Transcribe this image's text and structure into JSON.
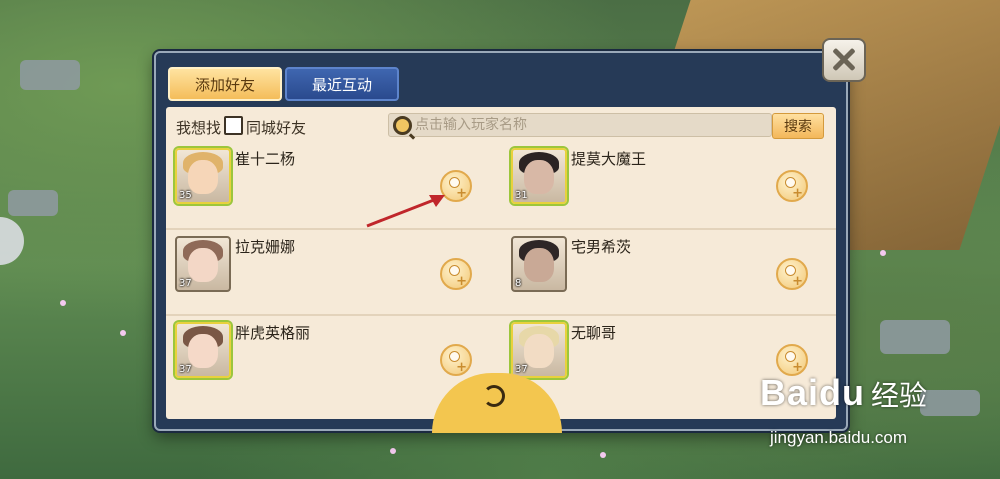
{
  "tabs": [
    {
      "label": "添加好友",
      "active": true
    },
    {
      "label": "最近互动",
      "active": false
    }
  ],
  "filter": {
    "find_label": "我想找",
    "same_city_label": "同城好友",
    "same_city_checked": false
  },
  "search": {
    "placeholder": "点击输入玩家名称",
    "button_label": "搜索"
  },
  "friends": [
    {
      "name": "崔十二杨",
      "level": "35",
      "frame": "gold",
      "hair": "#e0b36a",
      "skin": "#f6d6b8"
    },
    {
      "name": "提莫大魔王",
      "level": "31",
      "frame": "gold",
      "hair": "#2b2323",
      "skin": "#d8b8a6"
    },
    {
      "name": "拉克姗娜",
      "level": "37",
      "frame": "plain",
      "hair": "#8f6a58",
      "skin": "#f3d7c6"
    },
    {
      "name": "宅男希茨",
      "level": "8",
      "frame": "plain",
      "hair": "#2e2626",
      "skin": "#c9a996"
    },
    {
      "name": "胖虎英格丽",
      "level": "37",
      "frame": "gold",
      "hair": "#7a5745",
      "skin": "#f5d9c8"
    },
    {
      "name": "无聊哥",
      "level": "37",
      "frame": "gold",
      "hair": "#e7d8a8",
      "skin": "#f2dcc4"
    }
  ],
  "watermark": {
    "brand": "Bai",
    "brand2": "du",
    "cn": "经验",
    "url": "jingyan.baidu.com"
  },
  "colors": {
    "panel": "#263a57",
    "content": "#f6ead8",
    "accent": "#f3c64f",
    "annotation_arrow": "#c0262b"
  },
  "icons": [
    "close-icon",
    "search-icon",
    "add-friend-icon",
    "refresh-icon"
  ]
}
